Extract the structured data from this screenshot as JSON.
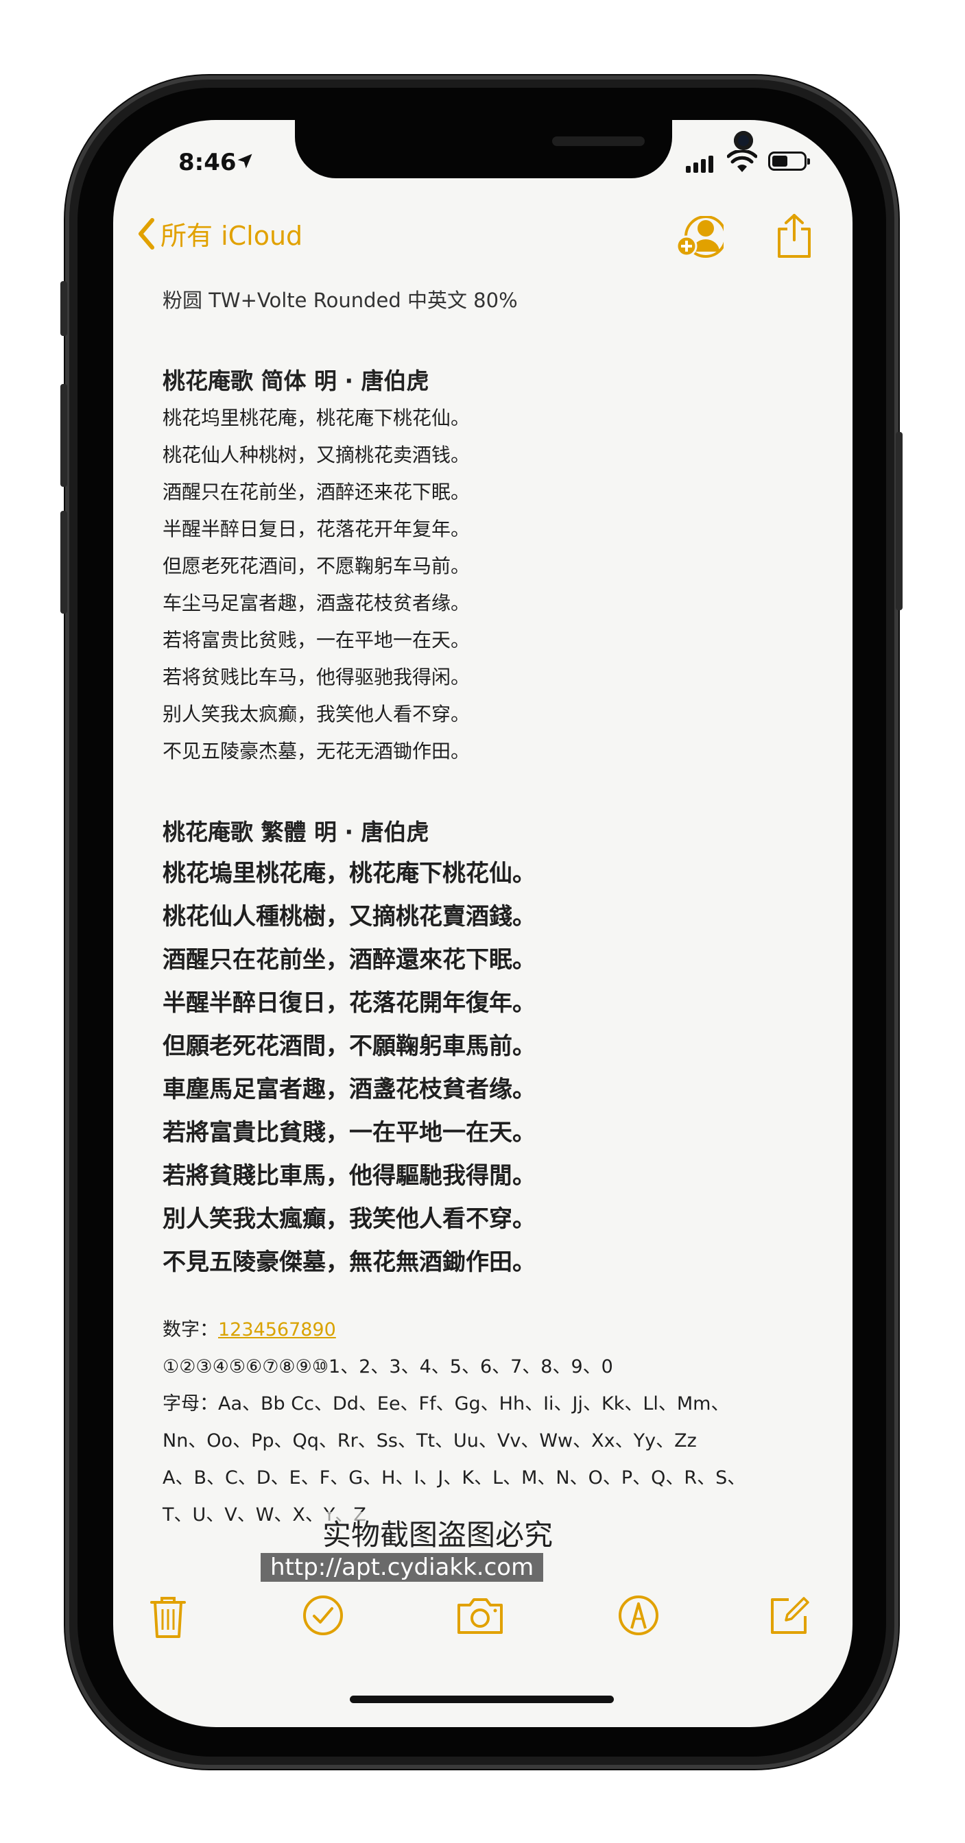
{
  "status_bar": {
    "time": "8:46"
  },
  "nav": {
    "back_label": "所有 iCloud"
  },
  "note": {
    "font_caption": "粉圆 TW+Volte Rounded 中英文 80%",
    "simplified": {
      "heading": "桃花庵歌 简体  明 · 唐伯虎",
      "lines": [
        "桃花坞里桃花庵，桃花庵下桃花仙。",
        "桃花仙人种桃树，又摘桃花卖酒钱。",
        "酒醒只在花前坐，酒醉还来花下眠。",
        "半醒半醉日复日，花落花开年复年。",
        "但愿老死花酒间，不愿鞠躬车马前。",
        "车尘马足富者趣，酒盏花枝贫者缘。",
        "若将富贵比贫贱，一在平地一在天。",
        "若将贫贱比车马，他得驱驰我得闲。",
        "别人笑我太疯癫，我笑他人看不穿。",
        "不见五陵豪杰墓，无花无酒锄作田。"
      ]
    },
    "traditional": {
      "heading": "桃花庵歌 繁體    明 · 唐伯虎",
      "lines": [
        "桃花塢里桃花庵，桃花庵下桃花仙。",
        "桃花仙人種桃樹，又摘桃花賣酒錢。",
        "酒醒只在花前坐，酒醉還來花下眠。",
        "半醒半醉日復日，花落花開年復年。",
        "但願老死花酒間，不願鞠躬車馬前。",
        "車塵馬足富者趣，酒盞花枝貧者缘。",
        "若將富貴比貧賤，一在平地一在天。",
        "若將貧賤比車馬，他得驅馳我得閒。",
        "別人笑我太瘋癲，我笑他人看不穿。",
        "不見五陵豪傑墓，無花無酒鋤作田。"
      ]
    },
    "numbers_label": "数字：",
    "numbers_link": "1234567890",
    "circled_numbers": "①②③④⑤⑥⑦⑧⑨⑩1、2、3、4、5、6、7、8、9、0",
    "letters_line1": "字母：Aa、Bb Cc、Dd、Ee、Ff、Gg、Hh、Ii、Jj、Kk、Ll、Mm、",
    "letters_line2": "Nn、Oo、Pp、Qq、Rr、Ss、Tt、Uu、Vv、Ww、Xx、Yy、Zz",
    "letters_line3": "A、B、C、D、E、F、G、H、I、J、K、L、M、N、O、P、Q、R、S、",
    "letters_line4": "T、U、V、W、X、Y、Z"
  },
  "watermark": {
    "title": "实物截图盗图必究",
    "url": "http://apt.cydiakk.com"
  },
  "colors": {
    "accent": "#E1A100",
    "text": "#1F1F1F",
    "paper": "#F6F6F4"
  },
  "icons": {
    "back": "chevron-left-icon",
    "add_person": "add-person-icon",
    "share": "share-icon",
    "trash": "trash-icon",
    "checklist": "checkmark-circle-icon",
    "camera": "camera-icon",
    "markup": "pen-circle-icon",
    "compose": "compose-icon"
  }
}
